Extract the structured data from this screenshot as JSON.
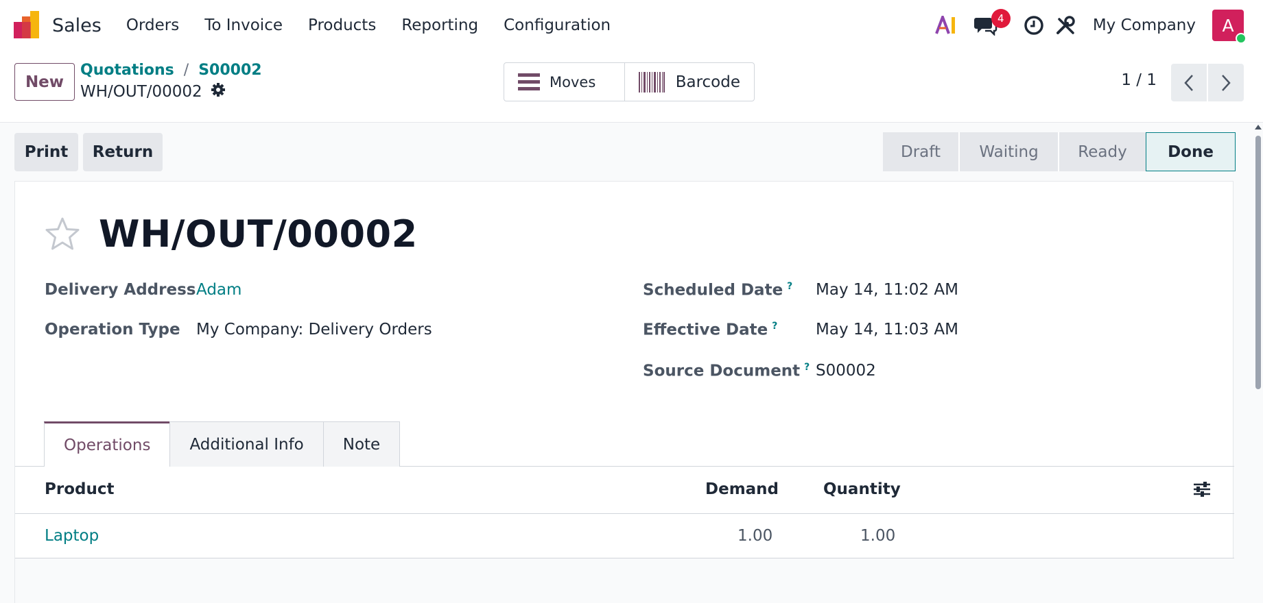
{
  "navbar": {
    "app_name": "Sales",
    "menu": [
      "Orders",
      "To Invoice",
      "Products",
      "Reporting",
      "Configuration"
    ],
    "ai_label": "AI",
    "messages_count": "4",
    "company": "My Company",
    "avatar_letter": "A"
  },
  "control": {
    "new_label": "New",
    "breadcrumb": [
      "Quotations",
      "S00002"
    ],
    "breadcrumb_sep": "/",
    "record_name": "WH/OUT/00002",
    "smart_buttons": {
      "moves": "Moves",
      "barcode": "Barcode"
    },
    "pager": "1 / 1"
  },
  "actions": {
    "print": "Print",
    "return": "Return"
  },
  "statusbar": {
    "stages": [
      "Draft",
      "Waiting",
      "Ready",
      "Done"
    ],
    "current": "Done"
  },
  "sheet": {
    "title": "WH/OUT/00002",
    "fields": {
      "delivery_address": {
        "label": "Delivery Address",
        "value": "Adam"
      },
      "operation_type": {
        "label": "Operation Type",
        "value": "My Company: Delivery Orders"
      },
      "scheduled_date": {
        "label": "Scheduled Date",
        "value": "May 14, 11:02 AM"
      },
      "effective_date": {
        "label": "Effective Date",
        "value": "May 14, 11:03 AM"
      },
      "source_document": {
        "label": "Source Document",
        "value": "S00002"
      },
      "help_mark": "?"
    },
    "tabs": [
      "Operations",
      "Additional Info",
      "Note"
    ],
    "table": {
      "headers": {
        "product": "Product",
        "demand": "Demand",
        "quantity": "Quantity"
      },
      "rows": [
        {
          "product": "Laptop",
          "demand": "1.00",
          "quantity": "1.00"
        }
      ]
    }
  },
  "colors": {
    "brand": "#714b67",
    "link": "#017e84",
    "badge": "#e0193b",
    "avatar": "#d1205c"
  }
}
